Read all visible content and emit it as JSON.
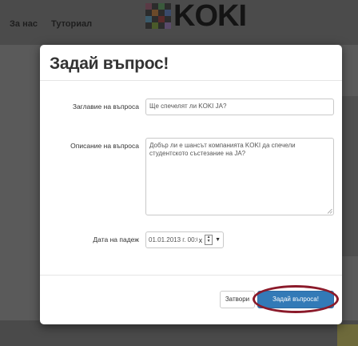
{
  "background": {
    "nav": [
      "За нас",
      "Туториал"
    ],
    "logo_text": "KOKI"
  },
  "modal": {
    "title": "Задай въпрос!",
    "title_label": "Заглавие на въпроса",
    "title_value": "Ще спечелят ли KOKI JA?",
    "description_label": "Описание на въпроса",
    "description_value": "Добър ли е шансът компанията KOKI да спечели студентското състезание на JA?",
    "date_label": "Дата на падеж",
    "date_value": "01.01.2013 г. 00:00",
    "date_clear": "x",
    "close_label": "Затвори",
    "ask_label": "Задай въпроса!"
  },
  "colors": {
    "primary": "#337ab7",
    "highlight": "#8b1a2a",
    "overlay": "#5a5a5a"
  }
}
